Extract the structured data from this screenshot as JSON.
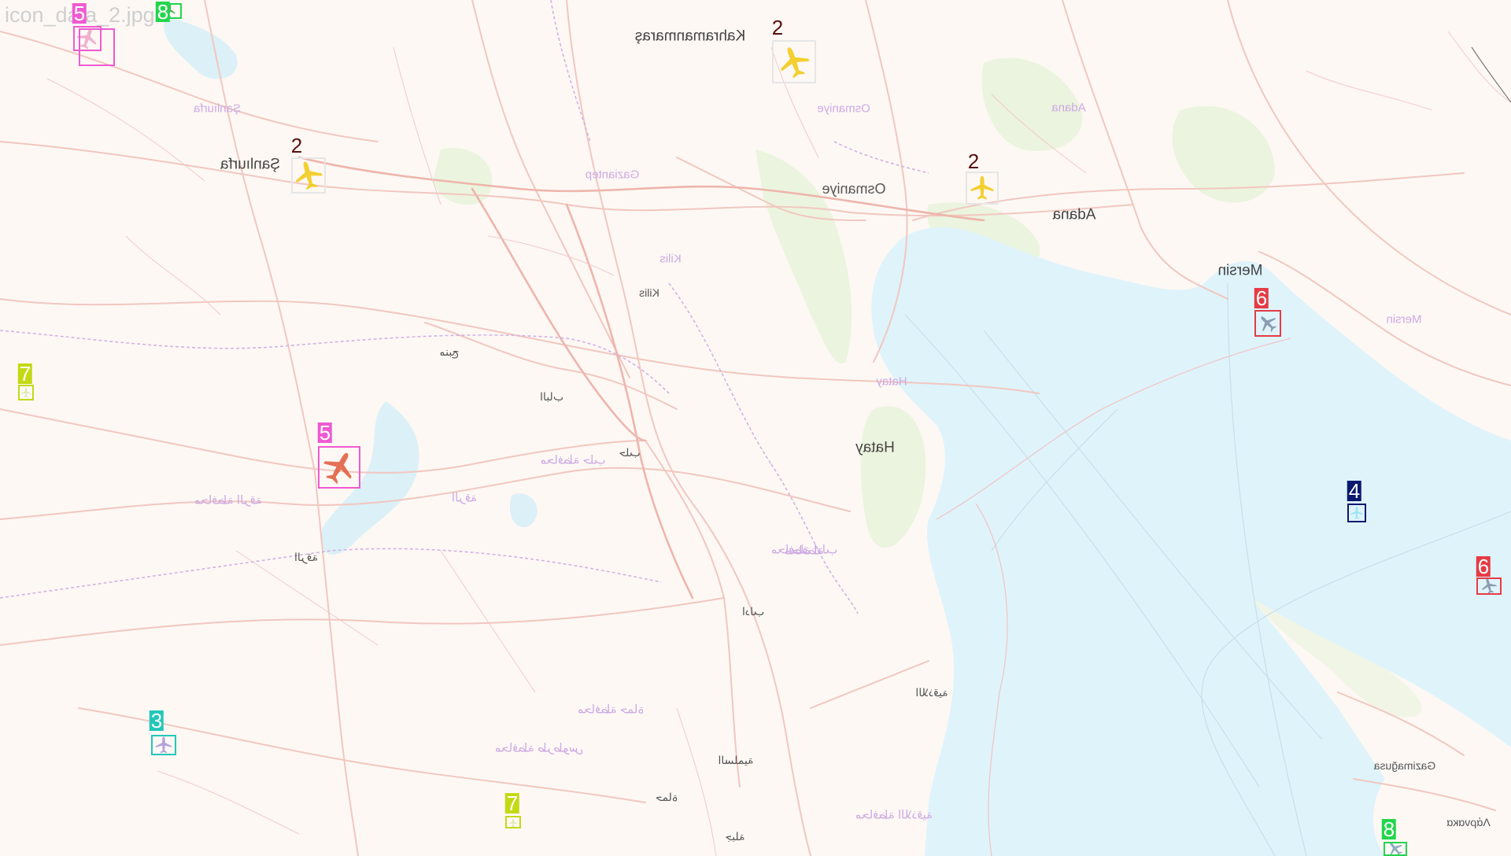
{
  "image_label": "icon_data_2.jpg",
  "colors": {
    "land": "#fdf8f4",
    "sea": "#dff3fb",
    "road": "#f1c7c0",
    "major_road": "#eeb5ac",
    "border": "#c9a4df",
    "park": "#e5f1d6",
    "class_2": "#5a0f0f",
    "class_3": "#23c7b8",
    "class_4": "#0b1a6e",
    "class_5": "#ef5ad2",
    "class_6": "#e53b45",
    "class_7": "#c3d914",
    "class_8": "#22d64c"
  },
  "places": [
    {
      "id": "kahramanmaras",
      "text": "Kahramanmaraş",
      "style": "dark mirror"
    },
    {
      "id": "sanliurfa",
      "text": "Şanlıurfa",
      "style": "dark mirror"
    },
    {
      "id": "osmaniye",
      "text": "Osmaniye",
      "style": "mirror"
    },
    {
      "id": "adana",
      "text": "Adana",
      "style": "dark mirror"
    },
    {
      "id": "mersin",
      "text": "Mersin",
      "style": "dark mirror"
    },
    {
      "id": "hatay",
      "text": "Hatay",
      "style": "dark mirror"
    },
    {
      "id": "kilis",
      "text": "Kilis",
      "style": "mirror small"
    },
    {
      "id": "gaziantep-faint",
      "text": "Gaziantep",
      "style": "faint mirror"
    },
    {
      "id": "osmaniye-faint",
      "text": "Osmaniye",
      "style": "faint mirror"
    },
    {
      "id": "adana-faint",
      "text": "Adana",
      "style": "faint mirror"
    },
    {
      "id": "mersin-faint",
      "text": "Mersin",
      "style": "faint mirror"
    },
    {
      "id": "hatay-faint",
      "text": "Hatay",
      "style": "faint mirror"
    },
    {
      "id": "kilis-faint",
      "text": "Kilis",
      "style": "faint mirror"
    },
    {
      "id": "sanliurfa-faint",
      "text": "Şanlıurfa",
      "style": "faint mirror"
    },
    {
      "id": "gazimagusa",
      "text": "Gazimağusa",
      "style": "mirror small"
    },
    {
      "id": "larnaka",
      "text": "Λάρνακα",
      "style": "mirror small"
    },
    {
      "id": "arabic-halab",
      "text": "حلب",
      "style": "mirror small"
    },
    {
      "id": "arabic-albab",
      "text": "الباب",
      "style": "mirror small"
    },
    {
      "id": "arabic-manbij",
      "text": "منبج",
      "style": "mirror small"
    },
    {
      "id": "arabic-idlib",
      "text": "ادلب",
      "style": "mirror small"
    },
    {
      "id": "arabic-raqqa",
      "text": "الرقة",
      "style": "mirror small"
    },
    {
      "id": "arabic-hama",
      "text": "حماة",
      "style": "mirror small"
    },
    {
      "id": "arabic-salamiyah",
      "text": "السلمية",
      "style": "mirror small"
    },
    {
      "id": "arabic-muhafazat-halab",
      "text": "محافظة حلب",
      "style": "faint mirror"
    },
    {
      "id": "arabic-muhafazat-idlib",
      "text": "محافظة ادلب",
      "style": "faint mirror"
    },
    {
      "id": "arabic-muhafazat-latakia",
      "text": "محافظة اللاذقية",
      "style": "faint mirror"
    },
    {
      "id": "arabic-muhafazat-raqqa",
      "text": "محافظة الرقة",
      "style": "faint mirror"
    },
    {
      "id": "arabic-muhafazat-hama",
      "text": "محافظة حماة",
      "style": "faint mirror"
    },
    {
      "id": "arabic-muhafazat-tartus",
      "text": "محافظة طرطوس",
      "style": "faint mirror"
    },
    {
      "id": "arabic-latakia",
      "text": "اللاذقية",
      "style": "mirror small"
    },
    {
      "id": "arabic-jableh",
      "text": "جبلة",
      "style": "mirror small"
    },
    {
      "id": "arabic-faint-1",
      "text": "محافظة",
      "style": "faint mirror"
    },
    {
      "id": "arabic-faint-2",
      "text": "الرقة",
      "style": "faint mirror"
    }
  ],
  "detections": [
    {
      "id": "det-2-kahramanmaras",
      "label": "2",
      "cls": "class_2",
      "plane_color": "#f2c80f",
      "box_color": "#e6e6e6"
    },
    {
      "id": "det-2-sanliurfa",
      "label": "2",
      "cls": "class_2",
      "plane_color": "#f2c80f",
      "box_color": "#e6e6e6"
    },
    {
      "id": "det-2-adana",
      "label": "2",
      "cls": "class_2",
      "plane_color": "#f2c80f",
      "box_color": "#e6e6e6"
    },
    {
      "id": "det-5-topleft",
      "label": "5",
      "cls": "class_5",
      "plane_color": "#f0a4c8",
      "box_color": "#ef5ad2"
    },
    {
      "id": "det-5-center",
      "label": "5",
      "cls": "class_5",
      "plane_color": "#e05a3a",
      "box_color": "#ef5ad2"
    },
    {
      "id": "det-8-topleft",
      "label": "8",
      "cls": "class_8",
      "plane_color": "#2b9c3a",
      "box_color": "#22d64c"
    },
    {
      "id": "det-8-bottomright",
      "label": "8",
      "cls": "class_8",
      "plane_color": "#7fa2b8",
      "box_color": "#22d64c"
    },
    {
      "id": "det-7-left",
      "label": "7",
      "cls": "class_7",
      "plane_color": "#d6e7a0",
      "box_color": "#c3d914"
    },
    {
      "id": "det-7-bottom",
      "label": "7",
      "cls": "class_7",
      "plane_color": "#d6e7a0",
      "box_color": "#c3d914"
    },
    {
      "id": "det-3",
      "label": "3",
      "cls": "class_3",
      "plane_color": "#a896d9",
      "box_color": "#23c7b8"
    },
    {
      "id": "det-4",
      "label": "4",
      "cls": "class_4",
      "plane_color": "#8fe3f5",
      "box_color": "#0b1a6e"
    },
    {
      "id": "det-6-mersin",
      "label": "6",
      "cls": "class_6",
      "plane_color": "#7e8fa6",
      "box_color": "#e53b45"
    },
    {
      "id": "det-6-right",
      "label": "6",
      "cls": "class_6",
      "plane_color": "#7e8fa6",
      "box_color": "#e53b45"
    }
  ]
}
